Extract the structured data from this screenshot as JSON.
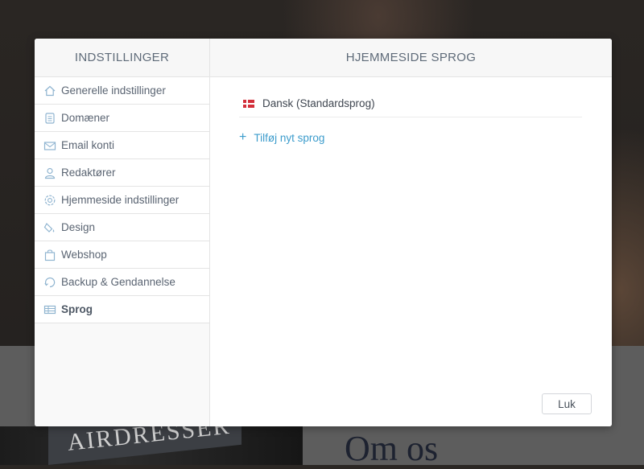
{
  "background": {
    "photo_sign_text": "AIRDRESSER",
    "heading": "Om os"
  },
  "sidebar": {
    "title": "INDSTILLINGER",
    "items": [
      {
        "label": "Generelle indstillinger",
        "icon": "home-icon"
      },
      {
        "label": "Domæner",
        "icon": "document-icon"
      },
      {
        "label": "Email konti",
        "icon": "envelope-icon"
      },
      {
        "label": "Redaktører",
        "icon": "user-icon"
      },
      {
        "label": "Hjemmeside indstillinger",
        "icon": "gear-icon"
      },
      {
        "label": "Design",
        "icon": "paint-bucket-icon"
      },
      {
        "label": "Webshop",
        "icon": "shopping-bag-icon"
      },
      {
        "label": "Backup & Gendannelse",
        "icon": "restore-icon"
      },
      {
        "label": "Sprog",
        "icon": "language-icon",
        "active": true
      }
    ]
  },
  "main": {
    "title": "HJEMMESIDE SPROG",
    "languages": [
      {
        "label": "Dansk (Standardsprog)",
        "flag": "denmark-flag"
      }
    ],
    "add_language_label": "Tilføj nyt sprog",
    "close_label": "Luk"
  },
  "colors": {
    "accent": "#3c9ccc",
    "icon": "#8fb4d0",
    "text": "#5a6472"
  }
}
